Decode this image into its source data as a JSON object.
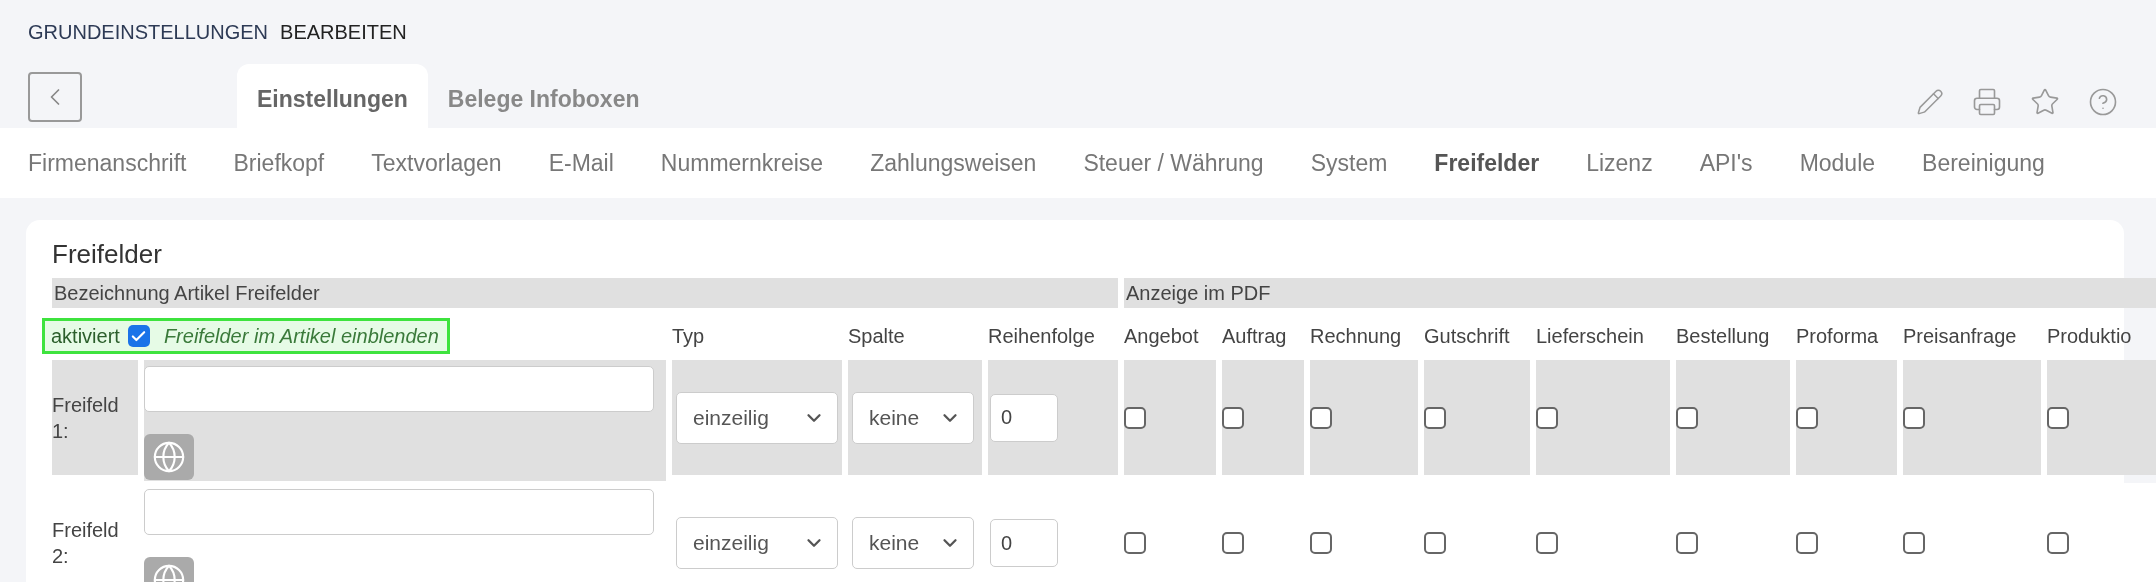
{
  "page_title": {
    "primary": "GRUNDEINSTELLUNGEN",
    "secondary": "BEARBEITEN"
  },
  "tabs": [
    {
      "label": "Einstellungen",
      "selected": true
    },
    {
      "label": "Belege Infoboxen",
      "selected": false
    }
  ],
  "nav": [
    {
      "label": "Firmenanschrift",
      "selected": false
    },
    {
      "label": "Briefkopf",
      "selected": false
    },
    {
      "label": "Textvorlagen",
      "selected": false
    },
    {
      "label": "E-Mail",
      "selected": false
    },
    {
      "label": "Nummernkreise",
      "selected": false
    },
    {
      "label": "Zahlungsweisen",
      "selected": false
    },
    {
      "label": "Steuer / Währung",
      "selected": false
    },
    {
      "label": "System",
      "selected": false
    },
    {
      "label": "Freifelder",
      "selected": true
    },
    {
      "label": "Lizenz",
      "selected": false
    },
    {
      "label": "API's",
      "selected": false
    },
    {
      "label": "Module",
      "selected": false
    },
    {
      "label": "Bereinigung",
      "selected": false
    }
  ],
  "card": {
    "title": "Freifelder",
    "groups": [
      "Bezeichnung Artikel Freifelder",
      "Anzeige im PDF"
    ],
    "activation": {
      "label": "aktiviert",
      "checked": true,
      "hint": "Freifelder im Artikel einblenden"
    },
    "columns": [
      "Typ",
      "Spalte",
      "Reihenfolge"
    ],
    "documents": [
      "Angebot",
      "Auftrag",
      "Rechnung",
      "Gutschrift",
      "Lieferschein",
      "Bestellung",
      "Proforma",
      "Preisanfrage",
      "Produktio"
    ],
    "rows": [
      {
        "label": "Freifeld 1:",
        "type": "einzeilig",
        "column": "keine",
        "order": "0",
        "pdf": [
          false,
          false,
          false,
          false,
          false,
          false,
          false,
          false,
          false
        ]
      },
      {
        "label": "Freifeld 2:",
        "type": "einzeilig",
        "column": "keine",
        "order": "0",
        "pdf": [
          false,
          false,
          false,
          false,
          false,
          false,
          false,
          false,
          false
        ]
      }
    ]
  }
}
